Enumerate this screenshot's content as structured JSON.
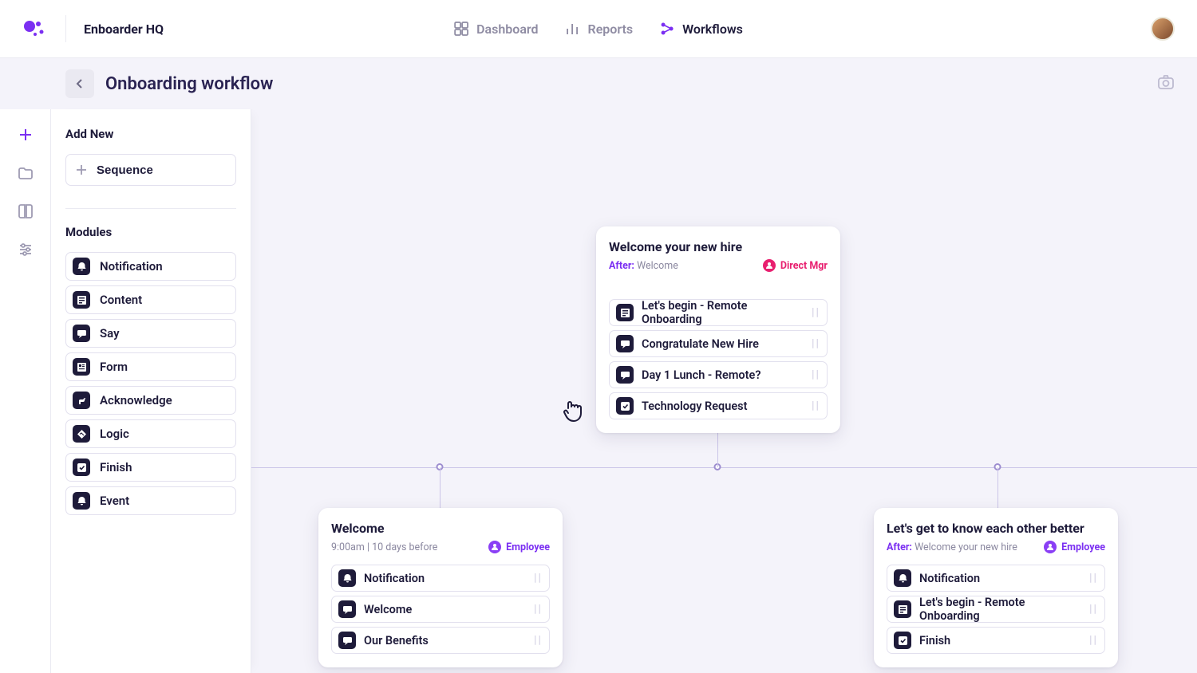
{
  "org_name": "Enboarder HQ",
  "nav": {
    "dashboard": "Dashboard",
    "reports": "Reports",
    "workflows": "Workflows"
  },
  "page_title": "Onboarding workflow",
  "sidebar": {
    "add_new_heading": "Add New",
    "sequence_label": "Sequence",
    "modules_heading": "Modules",
    "modules": [
      {
        "label": "Notification"
      },
      {
        "label": "Content"
      },
      {
        "label": "Say"
      },
      {
        "label": "Form"
      },
      {
        "label": "Acknowledge"
      },
      {
        "label": "Logic"
      },
      {
        "label": "Finish"
      },
      {
        "label": "Event"
      }
    ]
  },
  "nodes": {
    "top": {
      "title": "Welcome your new hire",
      "after_label": "After:",
      "after_value": "Welcome",
      "badge": "Direct Mgr",
      "items": [
        {
          "label": "Let's begin - Remote Onboarding"
        },
        {
          "label": "Congratulate New Hire"
        },
        {
          "label": "Day 1 Lunch - Remote?"
        },
        {
          "label": "Technology Request"
        }
      ]
    },
    "left": {
      "title": "Welcome",
      "meta": "9:00am  |  10 days before",
      "badge": "Employee",
      "items": [
        {
          "label": "Notification"
        },
        {
          "label": "Welcome"
        },
        {
          "label": "Our Benefits"
        }
      ]
    },
    "right": {
      "title": "Let's get to know each other better",
      "after_label": "After:",
      "after_value": "Welcome your new hire",
      "badge": "Employee",
      "items": [
        {
          "label": "Notification"
        },
        {
          "label": "Let's begin - Remote Onboarding"
        },
        {
          "label": "Finish"
        }
      ]
    }
  }
}
